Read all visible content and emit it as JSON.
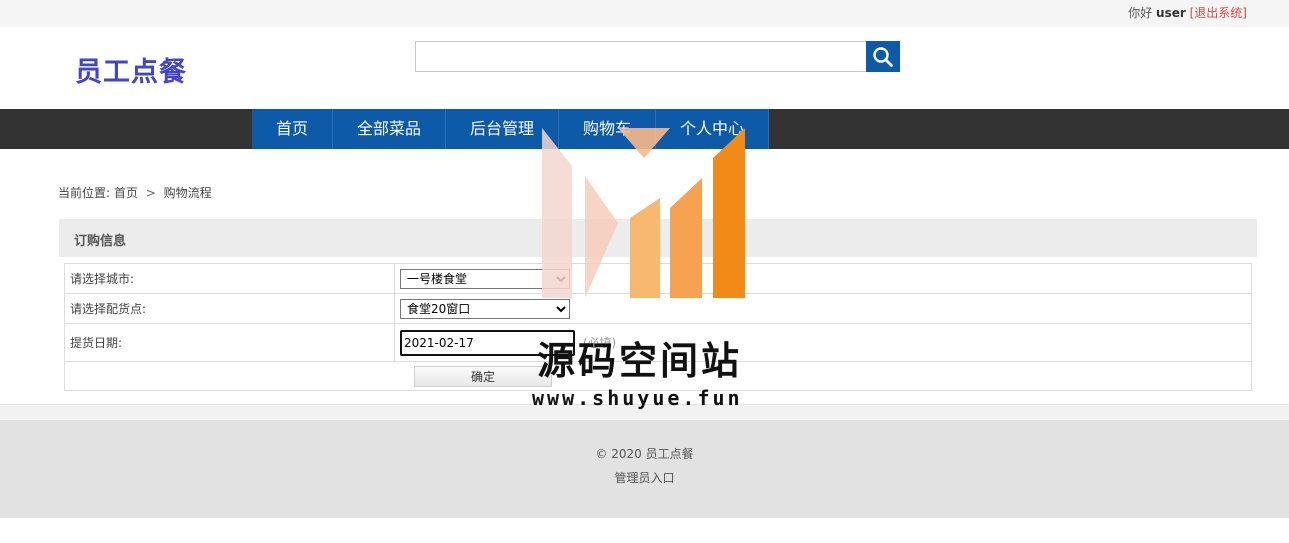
{
  "topbar": {
    "greeting": "你好",
    "username": "user",
    "logout_label": "[退出系统]"
  },
  "header": {
    "logo_text": "员工点餐",
    "search_placeholder": ""
  },
  "nav": {
    "items": [
      {
        "label": "首页"
      },
      {
        "label": "全部菜品"
      },
      {
        "label": "后台管理"
      },
      {
        "label": "购物车"
      },
      {
        "label": "个人中心"
      }
    ]
  },
  "breadcrumb": {
    "prefix": "当前位置:",
    "home": "首页",
    "separator": ">",
    "current": "购物流程"
  },
  "order": {
    "section_title": "订购信息",
    "city_label": "请选择城市:",
    "city_value": "一号楼食堂",
    "point_label": "请选择配货点:",
    "point_value": "食堂20窗口",
    "date_label": "提货日期:",
    "date_value": "2021-02-17",
    "date_note": "(必填)",
    "submit_label": "确定"
  },
  "footer": {
    "copyright": "© 2020 员工点餐",
    "admin_link": "管理员入口"
  },
  "watermark": {
    "text_cn": "源码空间站",
    "text_url": "www.shuyue.fun"
  },
  "colors": {
    "brand_blue": "#0d5aa8",
    "logo_purple": "#4345c8",
    "nav_dark": "#333333",
    "logout_red": "#e0463c"
  },
  "icons": {
    "search_button": "search-icon"
  }
}
